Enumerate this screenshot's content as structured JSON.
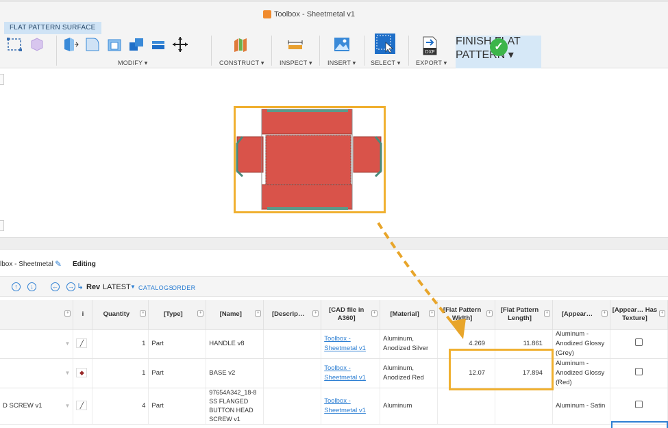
{
  "window": {
    "title": "Toolbox - Sheetmetal v1"
  },
  "toolbar": {
    "active_tab": "FLAT PATTERN SURFACE",
    "groups": {
      "modify": "MODIFY ▾",
      "construct": "CONSTRUCT ▾",
      "inspect": "INSPECT ▾",
      "insert": "INSERT ▾",
      "select": "SELECT ▾",
      "export": "EXPORT ▾",
      "finish": "FINISH FLAT PATTERN ▾"
    },
    "dxf_label": "DXF"
  },
  "bom": {
    "document": "lbox - Sheetmetal",
    "status": "Editing",
    "rev_label": "Rev",
    "rev_value": "LATEST",
    "catalogs": "CATALOGS",
    "order": "ORDER",
    "columns": [
      "",
      "i",
      "Quantity",
      "[Type]",
      "[Name]",
      "[Descrip…",
      "[CAD file in A360]",
      "[Material]",
      "[Flat Pattern Width]",
      "[Flat Pattern Length]",
      "[Appear…",
      "[Appear… Has Texture]"
    ],
    "rows": [
      {
        "name_left": "",
        "qty": "1",
        "type": "Part",
        "name": "HANDLE v8",
        "desc": "",
        "cad": "Toolbox - Sheetmetal v1",
        "material": "Aluminum, Anodized Silver",
        "width": "4.269",
        "length": "11.861",
        "appearance": "Aluminum - Anodized Glossy (Grey)"
      },
      {
        "name_left": "",
        "qty": "1",
        "type": "Part",
        "name": "BASE v2",
        "desc": "",
        "cad": "Toolbox - Sheetmetal v1",
        "material": "Aluminum, Anodized Red",
        "width": "12.07",
        "length": "17.894",
        "appearance": "Aluminum - Anodized Glossy (Red)"
      },
      {
        "name_left": "D SCREW v1",
        "qty": "4",
        "type": "Part",
        "name": "97654A342_18-8 SS FLANGED BUTTON HEAD SCREW v1",
        "desc": "",
        "cad": "Toolbox - Sheetmetal v1",
        "material": "Aluminum",
        "width": "",
        "length": "",
        "appearance": "Aluminum - Satin"
      }
    ]
  },
  "colors": {
    "accent_blue": "#2d7fd3",
    "highlight": "#f0b030",
    "flat_red": "#d9534a",
    "finish_green": "#3cb54a"
  }
}
